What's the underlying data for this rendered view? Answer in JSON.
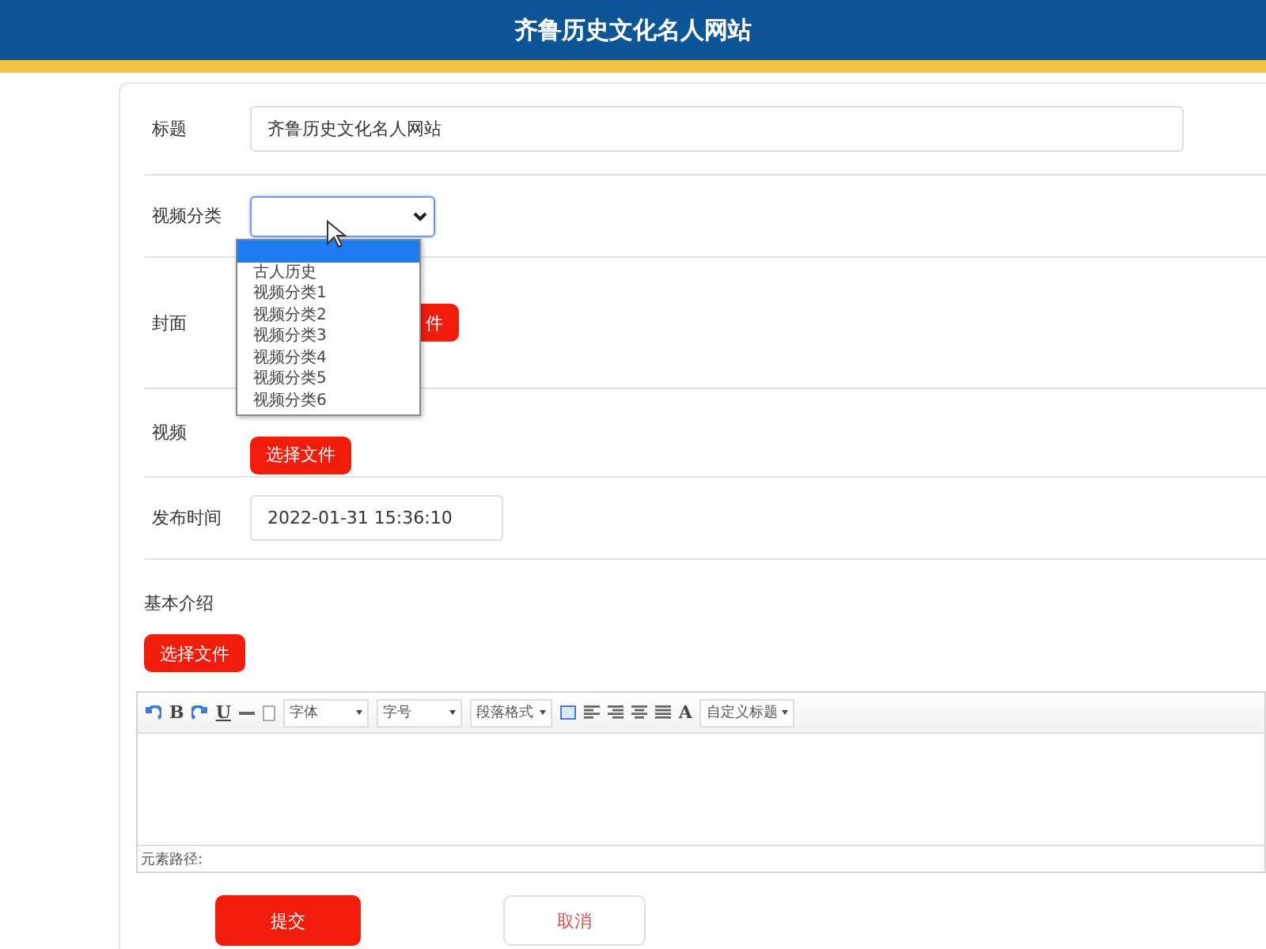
{
  "header": {
    "title": "齐鲁历史文化名人网站"
  },
  "form": {
    "title_field": {
      "label": "标题",
      "value": "齐鲁历史文化名人网站"
    },
    "category": {
      "label": "视频分类",
      "expanded": true,
      "options": [
        {
          "selected": true
        },
        {
          "label": "古人历史",
          "selected": false
        },
        {
          "label": "视频分类1",
          "selected": false
        },
        {
          "label": "视频分类2",
          "selected": false
        },
        {
          "label": "视频分类3",
          "selected": false
        },
        {
          "label": "视频分类4",
          "selected": false
        },
        {
          "label": "视频分类5",
          "selected": false
        },
        {
          "label": "视频分类6",
          "selected": false
        }
      ]
    },
    "cover": {
      "label": "封面",
      "button": "件"
    },
    "video": {
      "label": "视频",
      "button": "选择文件"
    },
    "publish_time": {
      "label": "发布时间",
      "value": "2022-01-31 15:36:10"
    },
    "intro": {
      "label": "基本介绍",
      "button": "选择文件",
      "toolbar": [
        {
          "kind": "icon"
        },
        {
          "kind": "glyph",
          "text": "B"
        },
        {
          "kind": "icon"
        },
        {
          "kind": "glyph",
          "text": "U"
        },
        {
          "kind": "icon"
        },
        {
          "kind": "icon"
        },
        {
          "kind": "select",
          "text": "字体"
        },
        {
          "kind": "select",
          "text": "字号"
        },
        {
          "kind": "select",
          "text": "段落格式"
        },
        {
          "kind": "icon"
        },
        {
          "kind": "icon"
        },
        {
          "kind": "icon"
        },
        {
          "kind": "icon"
        },
        {
          "kind": "icon"
        },
        {
          "kind": "glyph",
          "text": "A"
        },
        {
          "kind": "select",
          "text": "自定义标题"
        }
      ],
      "element_path": "元素路径:"
    },
    "submit": "提交",
    "cancel": "取消"
  }
}
